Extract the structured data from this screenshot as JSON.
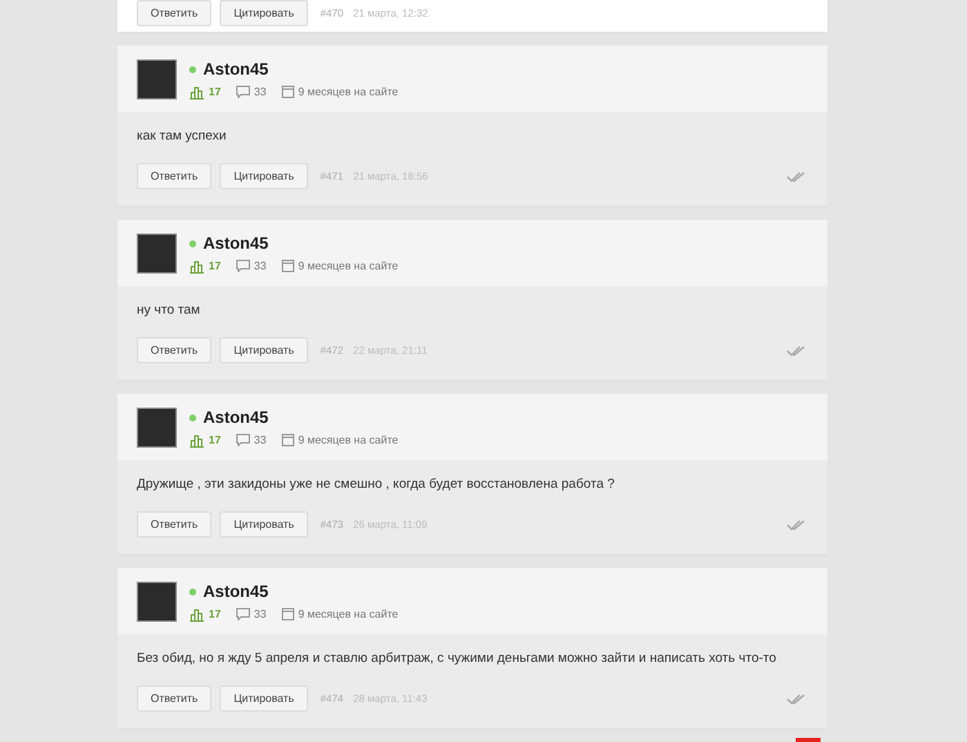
{
  "posts": [
    {
      "kind": "partial",
      "reply_button": "Ответить",
      "quote_button": "Цитировать",
      "number": "#470",
      "date": "21 марта, 12:32"
    },
    {
      "kind": "full",
      "author": "Aston45",
      "online": true,
      "rating": "17",
      "comments": "33",
      "membership": "9 месяцев на сайте",
      "text": "как там успехи",
      "reply_button": "Ответить",
      "quote_button": "Цитировать",
      "number": "#471",
      "date": "21 марта, 18:56"
    },
    {
      "kind": "full",
      "author": "Aston45",
      "online": true,
      "rating": "17",
      "comments": "33",
      "membership": "9 месяцев на сайте",
      "text": "ну что там",
      "reply_button": "Ответить",
      "quote_button": "Цитировать",
      "number": "#472",
      "date": "22 марта, 21:11"
    },
    {
      "kind": "full",
      "author": "Aston45",
      "online": true,
      "rating": "17",
      "comments": "33",
      "membership": "9 месяцев на сайте",
      "text": "Дружище , эти закидоны уже не смешно , когда будет восстановлена работа ?",
      "reply_button": "Ответить",
      "quote_button": "Цитировать",
      "number": "#473",
      "date": "26 марта, 11:09"
    },
    {
      "kind": "full",
      "author": "Aston45",
      "online": true,
      "rating": "17",
      "comments": "33",
      "membership": "9 месяцев на сайте",
      "text": "Без обид, но я жду 5 апреля и ставлю арбитраж,  с чужими деньгами можно зайти и написать хоть что-то",
      "reply_button": "Ответить",
      "quote_button": "Цитировать",
      "number": "#474",
      "date": "28 марта, 11:43"
    }
  ]
}
